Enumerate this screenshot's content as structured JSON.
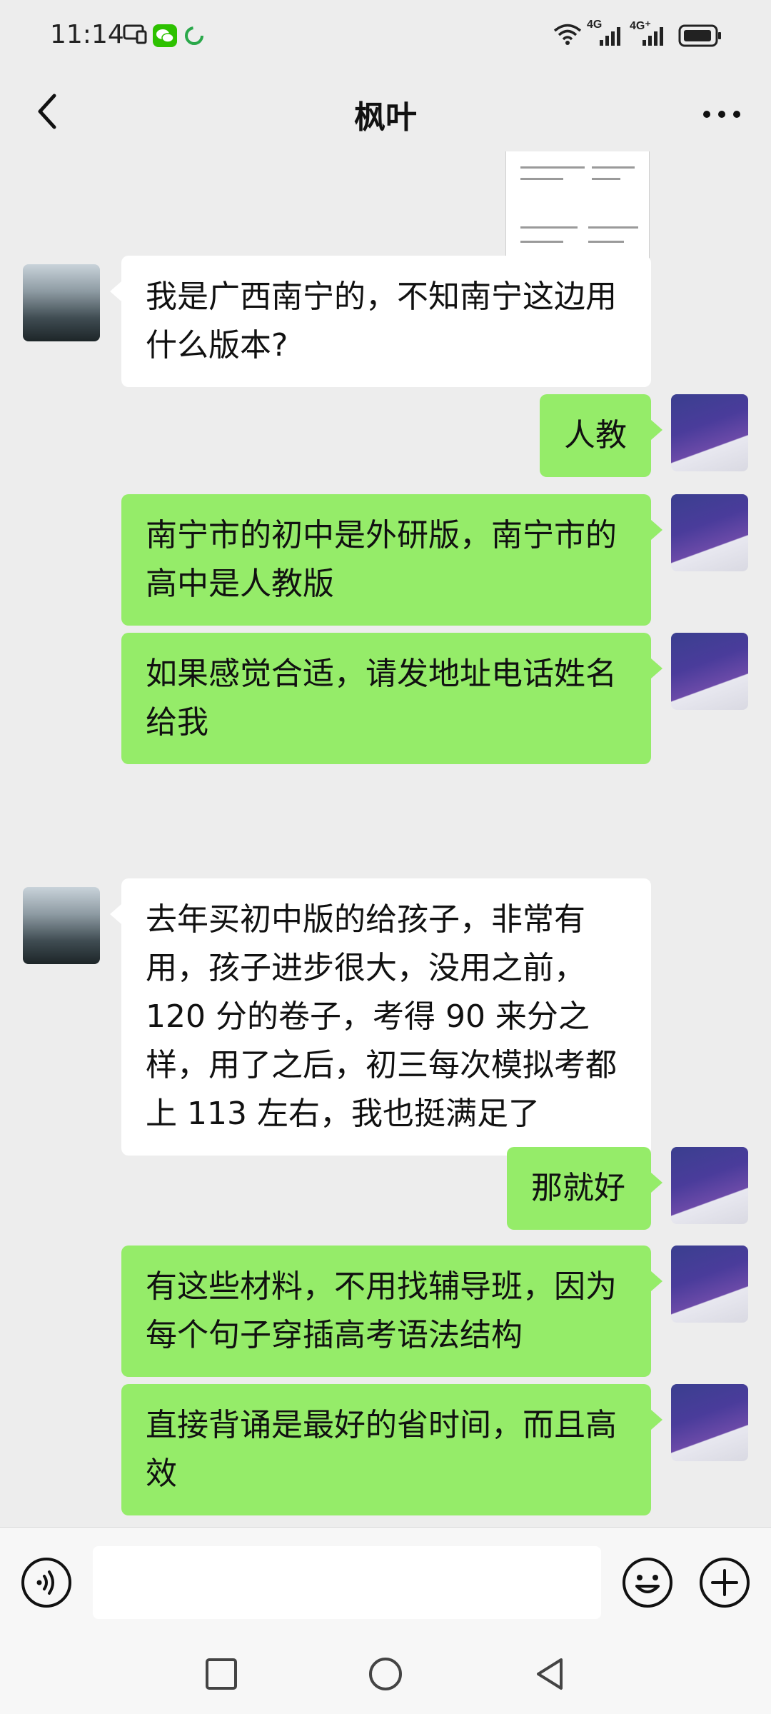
{
  "status_bar": {
    "time": "11:14",
    "net1": "4G",
    "net2": "4G⁺"
  },
  "header": {
    "title": "枫叶"
  },
  "messages": [
    {
      "from": "friend",
      "text": "我是广西南宁的，不知南宁这边用什么版本?"
    },
    {
      "from": "me",
      "text": "人教"
    },
    {
      "from": "me",
      "text": "南宁市的初中是外研版，南宁市的高中是人教版"
    },
    {
      "from": "me",
      "text": "如果感觉合适，请发地址电话姓名给我"
    },
    {
      "from": "friend",
      "text": "去年买初中版的给孩子，非常有用，孩子进步很大，没用之前，120 分的卷子，考得 90 来分之样，用了之后，初三每次模拟考都上 113 左右，我也挺满足了"
    },
    {
      "from": "me",
      "text": "那就好"
    },
    {
      "from": "me",
      "text": "有这些材料，不用找辅导班，因为每个句子穿插高考语法结构"
    },
    {
      "from": "me",
      "text": "直接背诵是最好的省时间，而且高效"
    }
  ],
  "input": {
    "placeholder": ""
  },
  "colors": {
    "friend_bubble": "#ffffff",
    "my_bubble": "#95ec69",
    "background": "#ededed"
  }
}
